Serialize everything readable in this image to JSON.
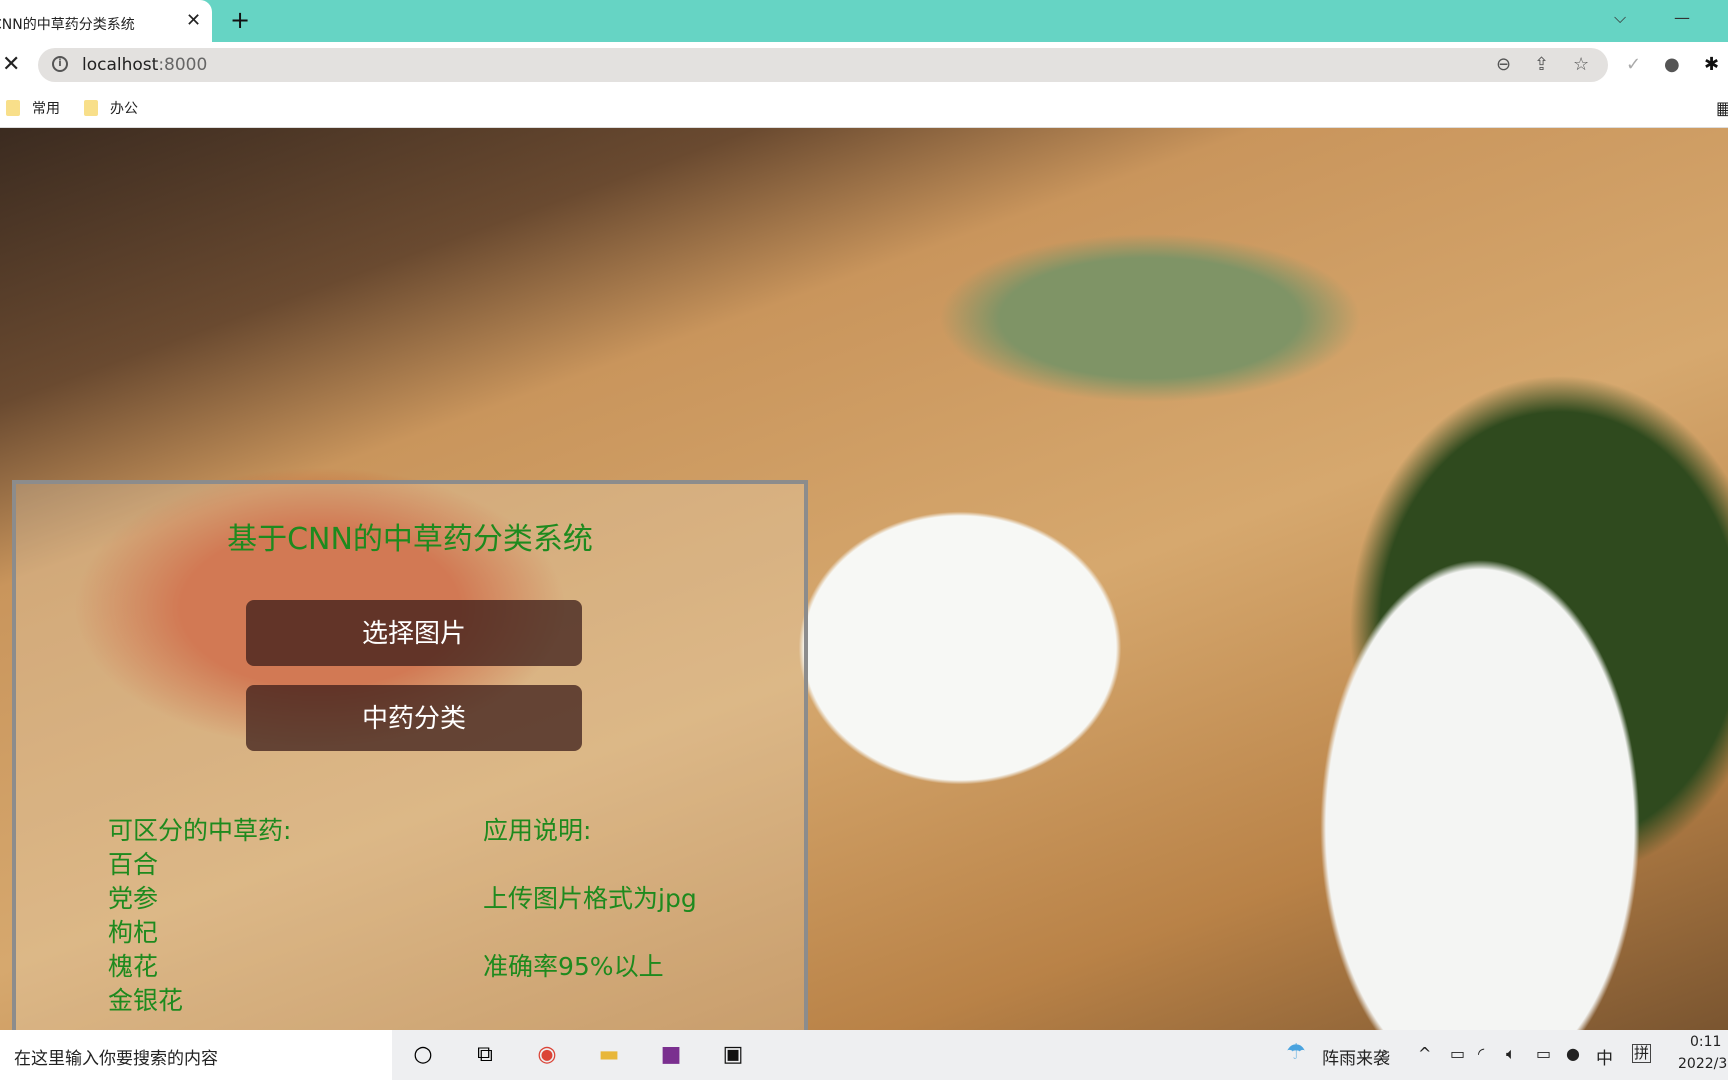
{
  "browser": {
    "tab_title": "CNN的中草药分类系统",
    "url_host": "localhost",
    "url_port": ":8000",
    "bookmarks": [
      {
        "label": "常用"
      },
      {
        "label": "办公"
      }
    ]
  },
  "panel": {
    "title": "基于CNN的中草药分类系统",
    "select_button": "选择图片",
    "classify_button": "中药分类",
    "herbs_heading": "可区分的中草药:",
    "herbs": [
      "百合",
      "党参",
      "枸杞",
      "槐花",
      "金银花"
    ],
    "usage_heading": "应用说明:",
    "usage": [
      "上传图片格式为jpg",
      "准确率95%以上"
    ]
  },
  "colors": {
    "tabbar": "#66d4c4",
    "text_green": "#1e8a1e"
  },
  "taskbar": {
    "search_placeholder": "在这里输入你要搜索的内容",
    "weather": "阵雨来袭",
    "ime_lang": "中",
    "ime_mode": "拼",
    "time": "0:11",
    "date": "2022/3"
  }
}
